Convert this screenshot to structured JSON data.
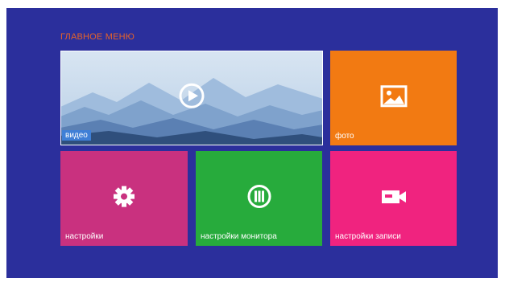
{
  "menu": {
    "title": "ГЛАВНОЕ МЕНЮ"
  },
  "tiles": [
    {
      "id": "video",
      "label": "видео",
      "icon": "play-icon",
      "color": "#cfdff0",
      "label_bg": "#3f7fd6"
    },
    {
      "id": "photo",
      "label": "фото",
      "icon": "image-icon",
      "color": "#f27a12"
    },
    {
      "id": "settings",
      "label": "настройки",
      "icon": "gear-icon",
      "color": "#c9317f"
    },
    {
      "id": "monitor",
      "label": "настройки монитора",
      "icon": "equalizer-icon",
      "color": "#27ab3c"
    },
    {
      "id": "record",
      "label": "настройки записи",
      "icon": "camera-icon",
      "color": "#f0237f"
    }
  ],
  "colors": {
    "background": "#2b2f9c",
    "title": "#e4622a"
  }
}
